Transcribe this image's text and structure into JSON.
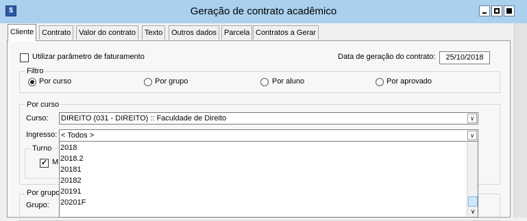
{
  "window": {
    "title": "Geração de contrato acadêmico",
    "icon": "app-icon",
    "controls": [
      "minimize-icon",
      "maximize-icon",
      "close-icon"
    ]
  },
  "tabs": [
    {
      "label": "Cliente",
      "active": true
    },
    {
      "label": "Contrato"
    },
    {
      "label": "Valor do contrato"
    },
    {
      "label": "Texto"
    },
    {
      "label": "Outros dados"
    },
    {
      "label": "Parcela"
    },
    {
      "label": "Contratos a Gerar"
    }
  ],
  "billing": {
    "use_param_label": "Utilizar parâmetro de faturamento",
    "use_param_checked": false,
    "date_label": "Data de geração do contrato:",
    "date_value": "25/10/2018"
  },
  "filter": {
    "title": "Filtro",
    "options": [
      "Por curso",
      "Por grupo",
      "Por aluno",
      "Por aprovado"
    ],
    "selected": "Por curso"
  },
  "por_curso": {
    "title": "Por curso",
    "curso_label": "Curso:",
    "curso_value": "DIREITO (031 - DIREITO) :: Faculdade de Direito",
    "ingresso_label": "Ingresso:",
    "ingresso_value": "< Todos >",
    "turno_title": "Turno",
    "turno_partial": "M",
    "turno_checked": true
  },
  "ingresso_options": [
    "2018",
    "2018.2",
    "20181",
    "20182",
    "20191",
    "20201F"
  ],
  "por_grupo": {
    "title": "Por grupo",
    "grupo_label": "Grupo:"
  },
  "colors": {
    "titlebar": "#a9d0ee",
    "panel_bg": "#f7f7f7",
    "window_bg": "#f0f0f0"
  }
}
